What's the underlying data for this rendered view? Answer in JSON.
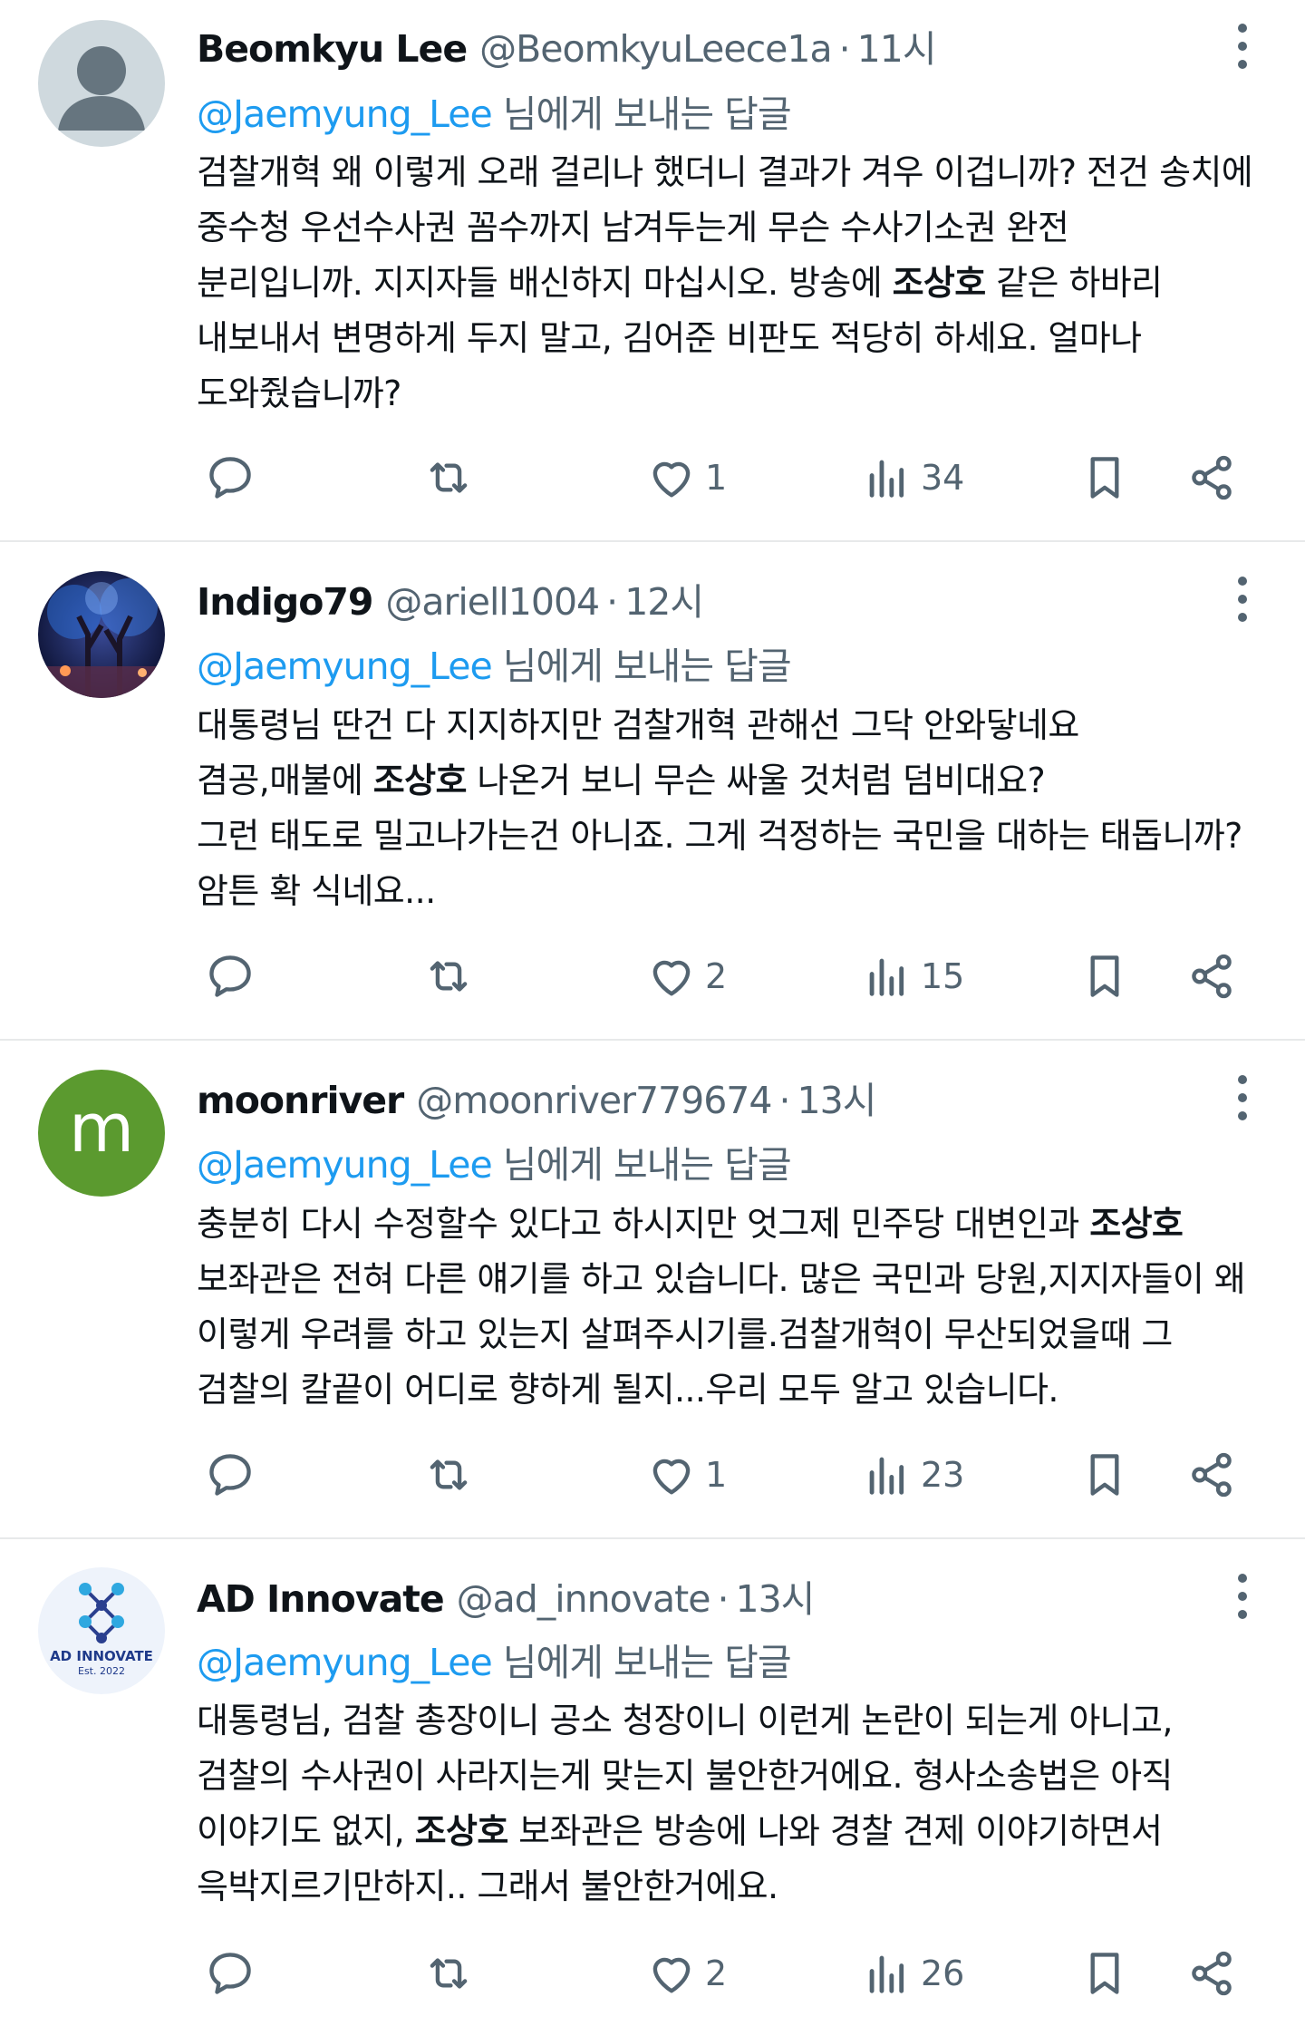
{
  "reply_prefix": "@Jaemyung_Lee",
  "reply_suffix": " 님에게 보내는 답글",
  "sep": "·",
  "tweets": [
    {
      "name": "Beomkyu Lee",
      "handle": "@BeomkyuLeece1a",
      "time": "11시",
      "avatar_icon": "default-profile-icon",
      "lines": [
        [
          "검찰개혁 왜 이렇게 오래 걸리나 했더니 결과가 겨우 이겁니까? 전건 송치에"
        ],
        [
          "중수청 우선수사권 꼼수까지 남겨두는게 무슨 수사기소권 완전"
        ],
        [
          "분리입니까. 지지자들 배신하지 마십시오. 방송에 ",
          "조상호",
          " 같은 하바리"
        ],
        [
          "내보내서 변명하게 두지 말고, 김어준 비판도 적당히 하세요. 얼마나"
        ],
        [
          "도와줬습니까?"
        ]
      ],
      "likes": "1",
      "views": "34"
    },
    {
      "name": "Indigo79",
      "handle": "@ariell1004",
      "time": "12시",
      "avatar_icon": "night-trees-lights-photo",
      "lines": [
        [
          "대통령님 딴건 다 지지하지만 검찰개혁 관해선 그닥 안와닿네요"
        ],
        [
          "겸공,매불에 ",
          "조상호",
          " 나온거 보니 무슨 싸울 것처럼 덤비대요?"
        ],
        [
          "그런 태도로 밀고나가는건 아니죠. 그게 걱정하는 국민을 대하는 태돕니까?"
        ],
        [
          "암튼 확 식네요..."
        ]
      ],
      "likes": "2",
      "views": "15"
    },
    {
      "name": "moonriver",
      "handle": "@moonriver779674",
      "time": "13시",
      "avatar_letter": "m",
      "avatar_color": "#5b9a2f",
      "lines": [
        [
          "충분히 다시 수정할수 있다고 하시지만 엇그제 민주당 대변인과 ",
          "조상호"
        ],
        [
          "보좌관은 전혀 다른 얘기를 하고 있습니다. 많은 국민과 당원,지지자들이 왜"
        ],
        [
          "이렇게 우려를 하고 있는지 살펴주시기를.검찰개혁이 무산되었을때 그"
        ],
        [
          "검찰의 칼끝이 어디로 향하게 될지...우리 모두 알고 있습니다."
        ]
      ],
      "likes": "1",
      "views": "23"
    },
    {
      "name": "AD Innovate",
      "handle": "@ad_innovate",
      "time": "13시",
      "avatar_logo_text": "AD INNOVATE",
      "avatar_logo_sub": "Est. 2022",
      "lines": [
        [
          "대통령님, 검찰 총장이니 공소 청장이니 이런게 논란이 되는게 아니고,"
        ],
        [
          "검찰의 수사권이 사라지는게 맞는지 불안한거에요. 형사소송법은 아직"
        ],
        [
          "이야기도 없지, ",
          "조상호",
          " 보좌관은 방송에 나와 경찰 견제 이야기하면서"
        ],
        [
          "윽박지르기만하지.. 그래서 불안한거에요."
        ]
      ],
      "likes": "2",
      "views": "26"
    }
  ],
  "icons": {
    "reply": "reply-bubble-icon",
    "retweet": "retweet-icon",
    "like": "heart-icon",
    "views": "views-bar-chart-icon",
    "bookmark": "bookmark-icon",
    "share": "share-icon",
    "more": "more-vertical-icon"
  },
  "colors": {
    "mention": "#1d9bf0",
    "muted": "#536471",
    "text": "#0f1419",
    "divider": "#e7e9ea"
  }
}
